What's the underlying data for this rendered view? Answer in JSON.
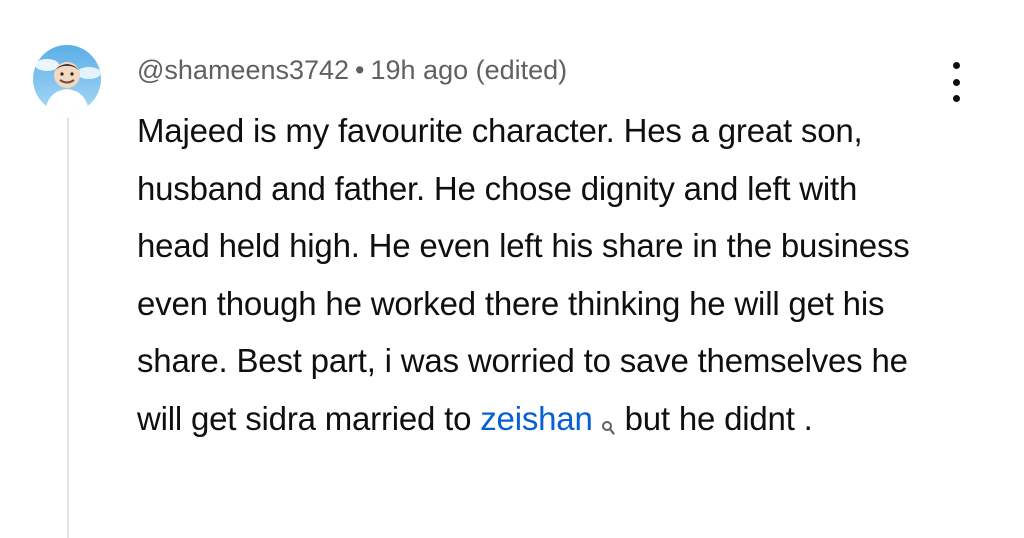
{
  "comment": {
    "author": "@shameens3742",
    "separator": "•",
    "time": "19h ago (edited)",
    "text_before_link": "Majeed is my favourite character. Hes a great son, husband and father. He chose dignity and left with head held high. He even left his share in the business even though he worked there thinking he will get his share. Best part, i was worried to save themselves he will get sidra married to ",
    "link_text": "zeishan",
    "text_after_link": "but he didnt .",
    "link_icon": "search-icon",
    "menu_icon": "more-vert-icon",
    "avatar_icon": "cartoon-avatar"
  },
  "colors": {
    "meta": "#606060",
    "text": "#0f0f0f",
    "link": "#065fd4",
    "thread_line": "#e2e2e2"
  }
}
